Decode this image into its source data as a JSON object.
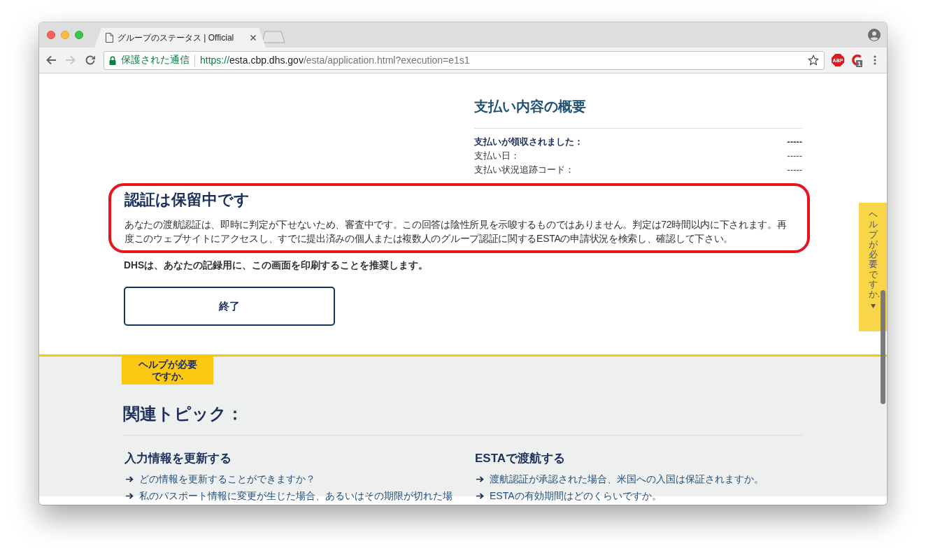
{
  "browser": {
    "tab": {
      "title": "グループのステータス | Official"
    },
    "nav_buttons": [
      {
        "kind": "back",
        "disabled": false
      },
      {
        "kind": "forward",
        "disabled": true
      },
      {
        "kind": "reload",
        "disabled": false
      }
    ],
    "address_bar": {
      "security_label": "保護された通信",
      "url_scheme": "https://",
      "url_host": "esta.cbp.dhs.gov",
      "url_path": "/esta/application.html?execution=e1s1"
    },
    "extensions": [
      {
        "kind": "text",
        "label": "ABP"
      },
      {
        "kind": "ring",
        "badge": "1"
      }
    ]
  },
  "payment_summary": {
    "title": "支払い内容の概要",
    "rows": [
      {
        "label": "支払いが領収されました：",
        "value": "-----",
        "emphasized": true
      },
      {
        "label": "支払い日：",
        "value": "-----",
        "emphasized": false
      },
      {
        "label": "支払い状況追跡コード：",
        "value": "-----",
        "emphasized": false
      }
    ]
  },
  "pending_notice": {
    "highlighted": true,
    "title": "認証は保留中です",
    "body": "あなたの渡航認証は、即時に判定が下せないため、審査中です。この回答は陰性所見を示唆するものではありません。判定は72時間以内に下されます。再度このウェブサイトにアクセスし、すでに提出済みの個人または複数人のグループ認証に関するESTAの申請状況を検索し、確認して下さい。"
  },
  "print_note": "DHSは、あなたの記録用に、この画面を印刷することを推奨します。",
  "finish_button": "終了",
  "help_tab": {
    "label": "ヘルプが必要ですか."
  },
  "side_help_tab": {
    "label": "ヘルプが必要ですか."
  },
  "related_topics": {
    "title": "関連トピック：",
    "columns": [
      {
        "heading": "入力情報を更新する",
        "links": [
          "どの情報を更新することができますか？",
          "私のパスポート情報に変更が生じた場合、あるいはその期限が切れた場"
        ]
      },
      {
        "heading": "ESTAで渡航する",
        "links": [
          "渡航認証が承認された場合、米国への入国は保証されますか。",
          "ESTAの有効期間はどのくらいですか。"
        ]
      }
    ]
  }
}
